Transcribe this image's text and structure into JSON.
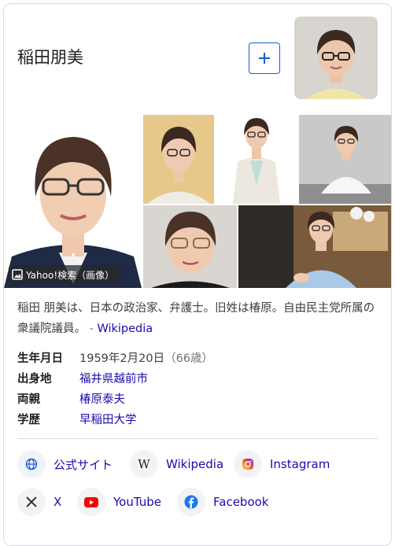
{
  "panel": {
    "title": "稲田朋美",
    "add_button_icon": "plus-icon"
  },
  "gallery": {
    "source_badge": "Yahoo!検索（画像）"
  },
  "description": {
    "text": "稲田 朋美は、日本の政治家、弁護士。旧姓は椿原。自由民主党所属の衆議院議員。",
    "separator": "-",
    "source_label": "Wikipedia"
  },
  "facts": [
    {
      "key": "生年月日",
      "value": "1959年2月20日",
      "extra": "（66歳）",
      "is_link": false
    },
    {
      "key": "出身地",
      "value": "福井県越前市",
      "is_link": true
    },
    {
      "key": "両親",
      "value": "椿原泰夫",
      "is_link": true
    },
    {
      "key": "学歴",
      "value": "早稲田大学",
      "is_link": true
    }
  ],
  "profiles": [
    {
      "label": "公式サイト",
      "icon": "globe-icon"
    },
    {
      "label": "Wikipedia",
      "icon": "wikipedia-icon"
    },
    {
      "label": "Instagram",
      "icon": "instagram-icon"
    },
    {
      "label": "X",
      "icon": "x-icon"
    },
    {
      "label": "YouTube",
      "icon": "youtube-icon"
    },
    {
      "label": "Facebook",
      "icon": "facebook-icon"
    }
  ],
  "colors": {
    "link": "#1a0dab",
    "accent": "#1a5bd6",
    "youtube": "#ff0000",
    "facebook": "#1877f2",
    "jacket_navy": "#1f2a44",
    "jacket_cream": "#efece5",
    "jacket_light_blue": "#aac8e8"
  }
}
